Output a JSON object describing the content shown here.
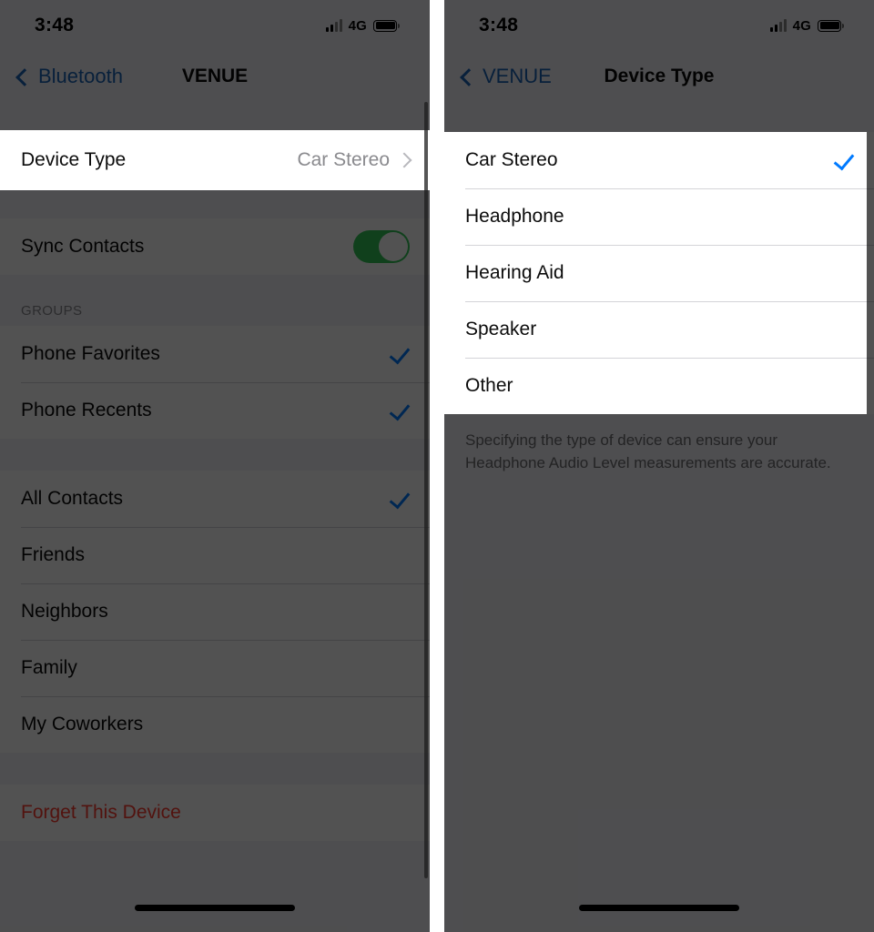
{
  "status_bar": {
    "time": "3:48",
    "network": "4G",
    "signal_icon": "signal-bars-icon",
    "battery_icon": "battery-full-icon"
  },
  "colors": {
    "accent_blue": "#007aff",
    "nav_blue": "#1b64b8",
    "toggle_green": "#34c759",
    "scrim": "rgba(0,0,0,0.68)",
    "cell_background": "#ffffff",
    "grouped_background": "#f2f2f7"
  },
  "left_panel": {
    "nav": {
      "back_label": "Bluetooth",
      "title": "VENUE"
    },
    "highlighted_row": {
      "label": "Device Type",
      "value": "Car Stereo",
      "accessory": "chevron-right-icon"
    },
    "sync_section": [
      {
        "label": "Sync Contacts",
        "accessory": "toggle",
        "toggle_on": true
      }
    ],
    "groups_header": "GROUPS",
    "groups": [
      {
        "label": "Phone Favorites",
        "checked": true
      },
      {
        "label": "Phone Recents",
        "checked": true
      }
    ],
    "contact_groups": [
      {
        "label": "All Contacts",
        "checked": true
      },
      {
        "label": "Friends",
        "checked": false
      },
      {
        "label": "Neighbors",
        "checked": false
      },
      {
        "label": "Family",
        "checked": false
      },
      {
        "label": "My Coworkers",
        "checked": false
      }
    ],
    "forget": {
      "label": "Forget This Device"
    }
  },
  "right_panel": {
    "nav": {
      "back_label": "VENUE",
      "title": "Device Type"
    },
    "options": [
      {
        "label": "Car Stereo",
        "checked": true
      },
      {
        "label": "Headphone",
        "checked": false
      },
      {
        "label": "Hearing Aid",
        "checked": false
      },
      {
        "label": "Speaker",
        "checked": false
      },
      {
        "label": "Other",
        "checked": false
      }
    ],
    "footnote": "Specifying the type of device can ensure your Headphone Audio Level measurements are accurate."
  }
}
